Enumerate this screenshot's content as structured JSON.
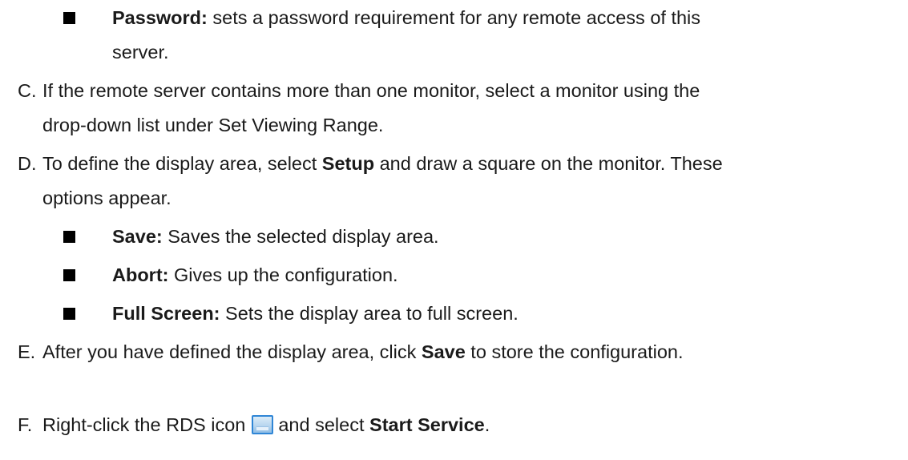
{
  "page": {
    "password_item": {
      "label": "Password:",
      "text_line1": " sets a password requirement for any remote access of this",
      "text_line2": "server."
    },
    "step_c": {
      "marker": "C.",
      "line1": "If the remote server contains more than one monitor, select a monitor using the",
      "line2": "drop-down list under Set Viewing Range."
    },
    "step_d": {
      "marker": "D.",
      "line1_a": "To define the display area, select ",
      "line1_bold": "Setup",
      "line1_b": " and draw a square on the monitor. These",
      "line2": "options appear.",
      "options": [
        {
          "label": "Save:",
          "text": " Saves the selected display area."
        },
        {
          "label": "Abort:",
          "text": " Gives up the configuration."
        },
        {
          "label": "Full Screen:",
          "text": " Sets the display area to full screen."
        }
      ]
    },
    "step_e": {
      "marker": "E.",
      "text_a": "After you have defined the display area, click ",
      "text_bold": "Save",
      "text_b": " to store the configuration."
    },
    "step_f": {
      "marker": "F.",
      "text_a": "Right-click the RDS icon",
      "icon": "rds-icon",
      "text_b": "and select ",
      "text_bold": "Start Service",
      "text_c": "."
    }
  }
}
